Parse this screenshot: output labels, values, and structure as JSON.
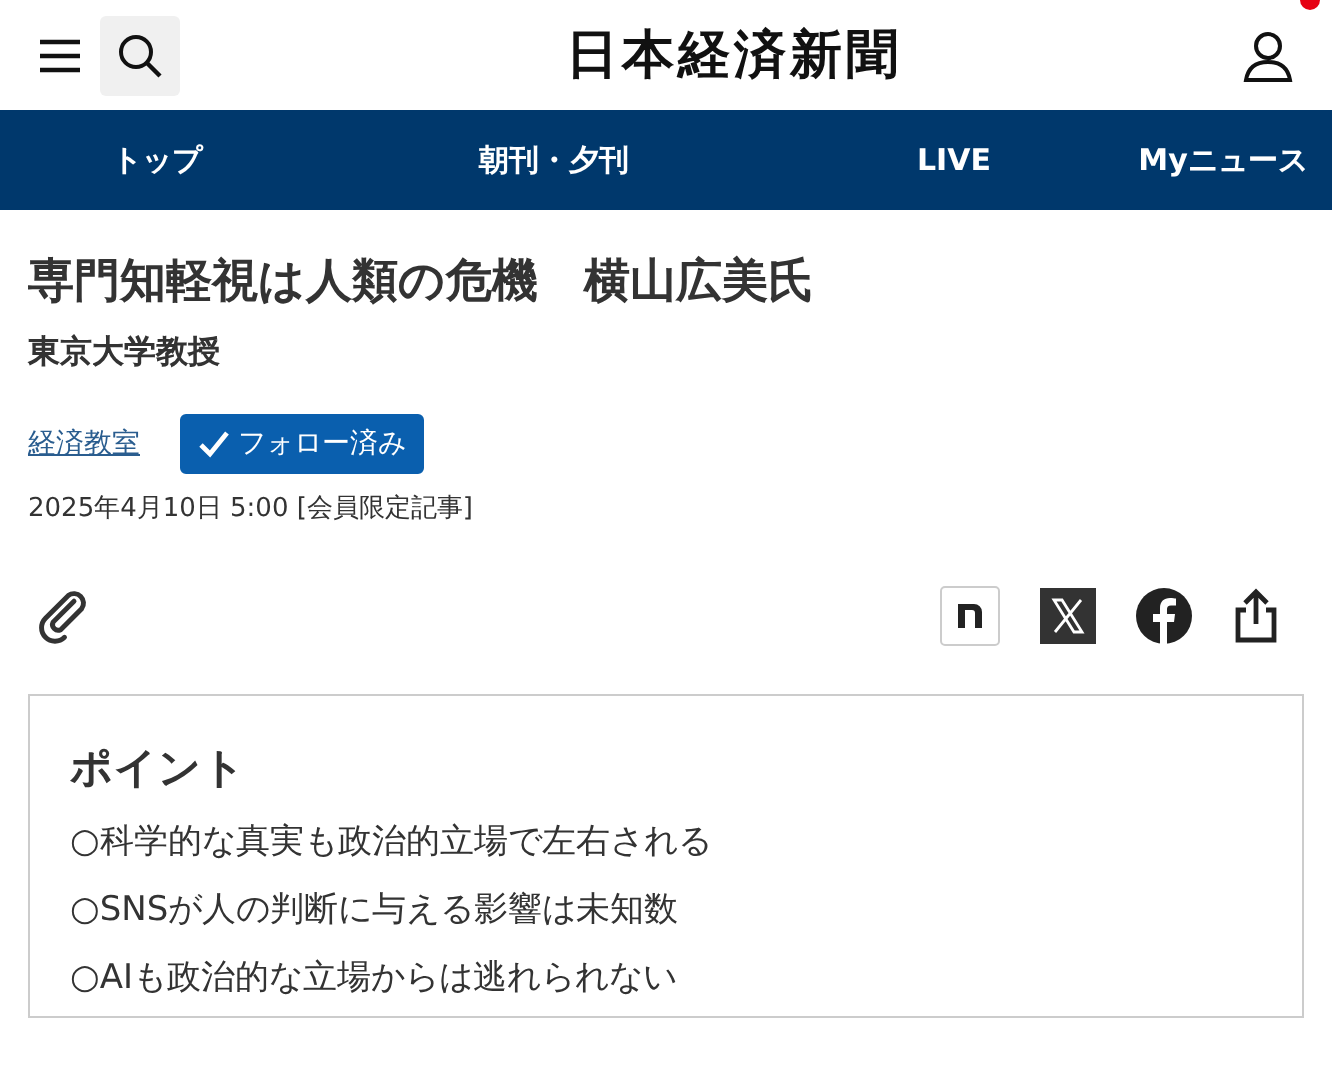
{
  "header": {
    "logo": "日本経済新聞",
    "notification": true
  },
  "nav": [
    {
      "label": "トップ"
    },
    {
      "label": "朝刊・夕刊"
    },
    {
      "label": "LIVE"
    },
    {
      "label": "Myニュース"
    }
  ],
  "article": {
    "title": "専門知軽視は人類の危機　横山広美氏",
    "subtitle": "東京大学教授",
    "series": "経済教室",
    "follow": {
      "label": "フォロー済み",
      "following": true
    },
    "date": "2025年4月10日 5:00 [会員限定記事]"
  },
  "points": {
    "heading": "ポイント",
    "items": [
      "○科学的な真実も政治的立場で左右される",
      "○SNSが人の判断に与える影響は未知数",
      "○AIも政治的な立場からは逃れられない"
    ]
  }
}
